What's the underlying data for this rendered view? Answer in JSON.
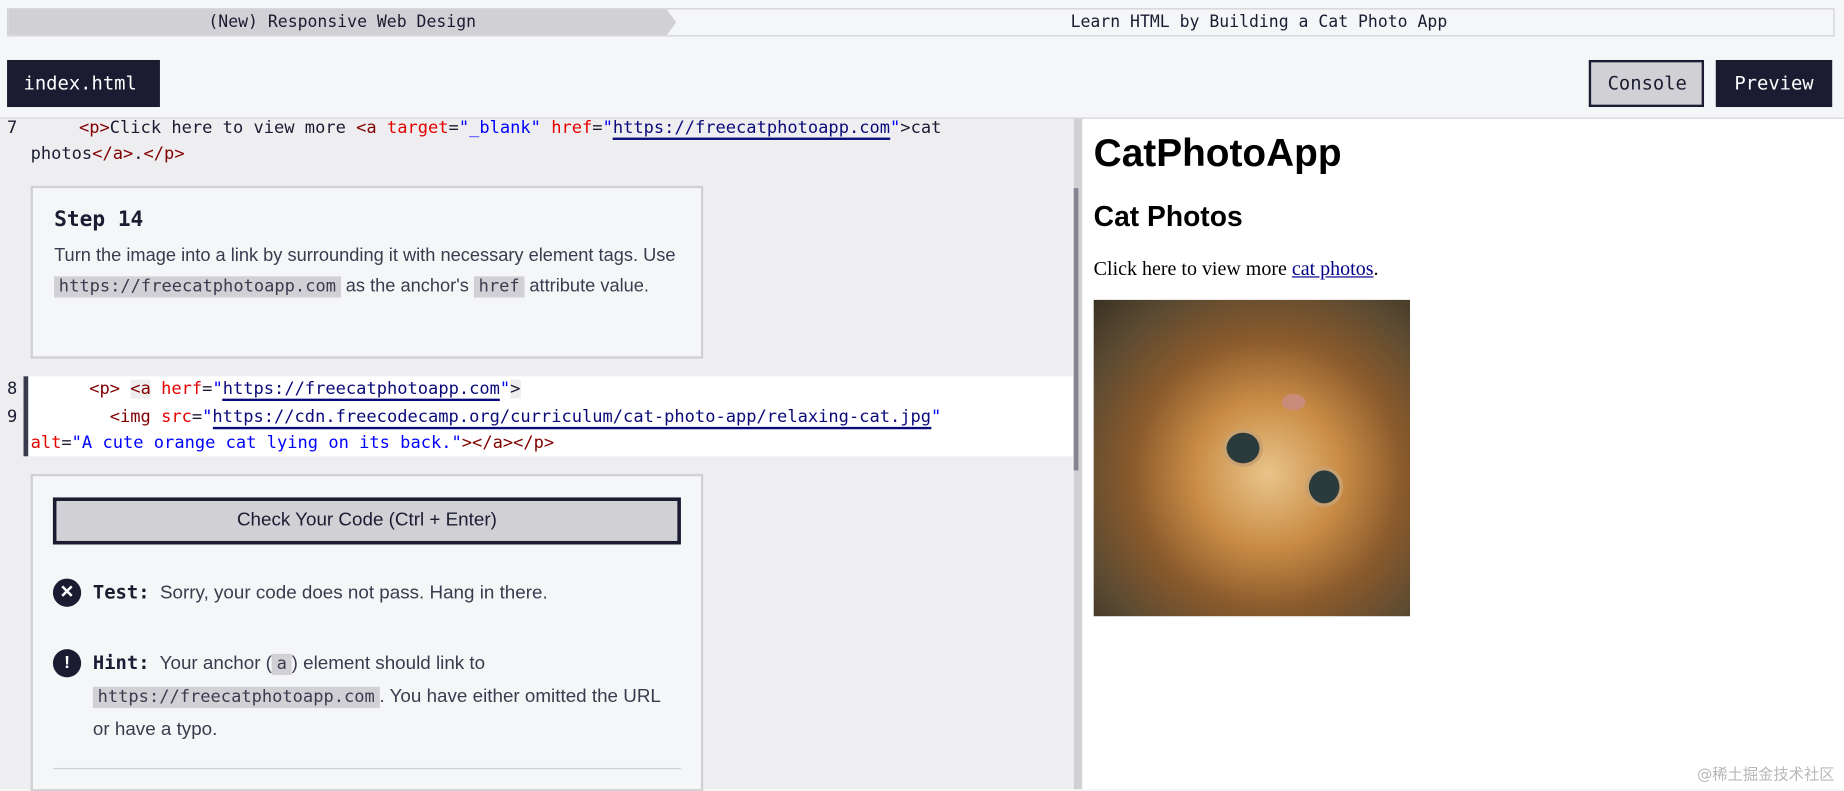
{
  "breadcrumb": {
    "course": "(New) Responsive Web Design",
    "project": "Learn HTML by Building a Cat Photo App"
  },
  "toolbar": {
    "file_tab": "index.html",
    "console": "Console",
    "preview": "Preview"
  },
  "editor": {
    "line7": {
      "num": "7",
      "indent": "      ",
      "p_open": "<p>",
      "text": "Click here to view more ",
      "a_open": "<a",
      "target_attr": " target",
      "eq": "=",
      "target_val": "\"_blank\"",
      "href_attr": " href",
      "href_q1": "\"",
      "href_url": "https://freecatphotoapp.com",
      "href_q2": "\"",
      "close": ">cat",
      "wrap": "photos",
      "a_close": "</a>",
      "dot": ".",
      "p_close": "</p>"
    },
    "line8": {
      "num": "8",
      "indent": "    ",
      "p": "<p>",
      "a": "<a",
      "attr": " herf",
      "eq": "=",
      "q1": "\"",
      "url": "https://freecatphotoapp.com",
      "q2": "\"",
      "gt": ">"
    },
    "line9": {
      "num": "9",
      "indent": "     ",
      "img": "<img",
      "attr": " src",
      "eq": "=",
      "q1": "\"",
      "url": "https://cdn.freecodecamp.org/curriculum/cat-photo-app/relaxing-cat.jpg",
      "q2": "\"",
      "alt": "alt",
      "alt_eq": "=",
      "alt_val": "\"A cute orange cat lying on its back.\"",
      "end": "></a></p>"
    }
  },
  "step": {
    "title": "Step 14",
    "text1": "Turn the image into a link by surrounding it with necessary element tags. Use ",
    "code1": "https://freecatphotoapp.com",
    "text2": " as the anchor's ",
    "code2": "href",
    "text3": " attribute value."
  },
  "check": {
    "button": "Check Your Code (Ctrl + Enter)",
    "test_label": "Test:",
    "test_text": "Sorry, your code does not pass. Hang in there.",
    "hint_label": "Hint:",
    "hint_text1": "Your anchor (",
    "hint_code1": "a",
    "hint_text2": ") element should link to ",
    "hint_code2": "https://freecatphotoapp.com",
    "hint_text3": ". You have either omitted the URL or have a typo."
  },
  "preview": {
    "h1": "CatPhotoApp",
    "h2": "Cat Photos",
    "p_text": "Click here to view more ",
    "link": "cat photos",
    "p_end": ".",
    "img_alt": "A cute orange cat lying on its back."
  },
  "watermark": "@稀土掘金技术社区"
}
